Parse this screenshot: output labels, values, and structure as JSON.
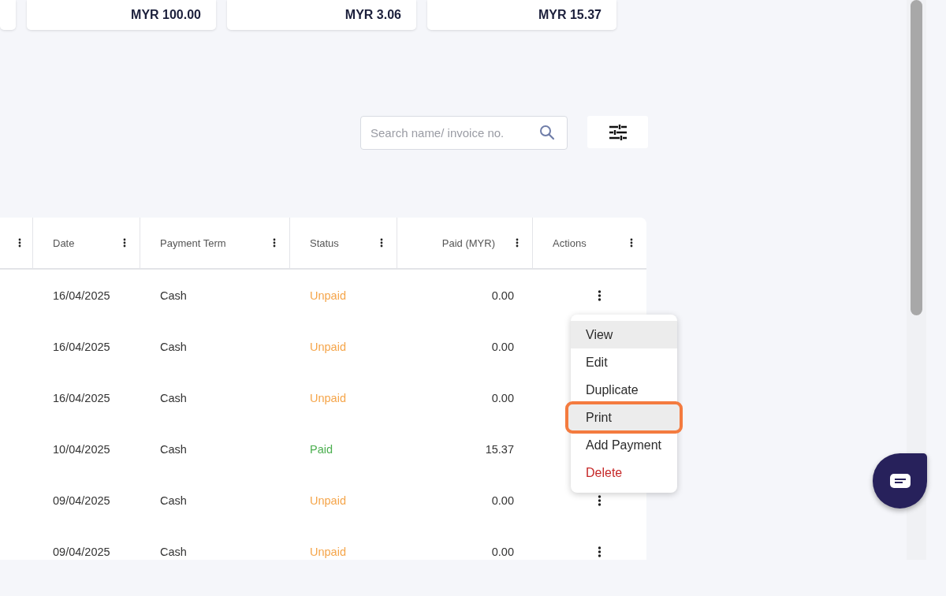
{
  "summary_cards": [
    {
      "amount": "MYR 100.00"
    },
    {
      "amount": "MYR 3.06"
    },
    {
      "amount": "MYR 15.37"
    }
  ],
  "search": {
    "placeholder": "Search name/ invoice no."
  },
  "table": {
    "columns": [
      "Date",
      "Payment Term",
      "Status",
      "Paid (MYR)",
      "Actions"
    ],
    "rows": [
      {
        "date": "16/04/2025",
        "payment_term": "Cash",
        "status": "Unpaid",
        "color": "#f5a54a",
        "paid": "0.00"
      },
      {
        "date": "16/04/2025",
        "payment_term": "Cash",
        "status": "Unpaid",
        "color": "#f5a54a",
        "paid": "0.00"
      },
      {
        "date": "16/04/2025",
        "payment_term": "Cash",
        "status": "Unpaid",
        "color": "#f5a54a",
        "paid": "0.00"
      },
      {
        "date": "10/04/2025",
        "payment_term": "Cash",
        "status": "Paid",
        "color": "#4caf50",
        "paid": "15.37"
      },
      {
        "date": "09/04/2025",
        "payment_term": "Cash",
        "status": "Unpaid",
        "color": "#f5a54a",
        "paid": "0.00"
      },
      {
        "date": "09/04/2025",
        "payment_term": "Cash",
        "status": "Unpaid",
        "color": "#f5a54a",
        "paid": "0.00"
      }
    ]
  },
  "action_menu": {
    "items": [
      {
        "label": "View",
        "kind": "normal",
        "hovered": true,
        "selected": false
      },
      {
        "label": "Edit",
        "kind": "normal",
        "hovered": false,
        "selected": false
      },
      {
        "label": "Duplicate",
        "kind": "normal",
        "hovered": false,
        "selected": false
      },
      {
        "label": "Print",
        "kind": "normal",
        "hovered": true,
        "selected": true
      },
      {
        "label": "Add Payment",
        "kind": "normal",
        "hovered": false,
        "selected": false
      },
      {
        "label": "Delete",
        "kind": "danger",
        "hovered": false,
        "selected": false
      }
    ]
  }
}
